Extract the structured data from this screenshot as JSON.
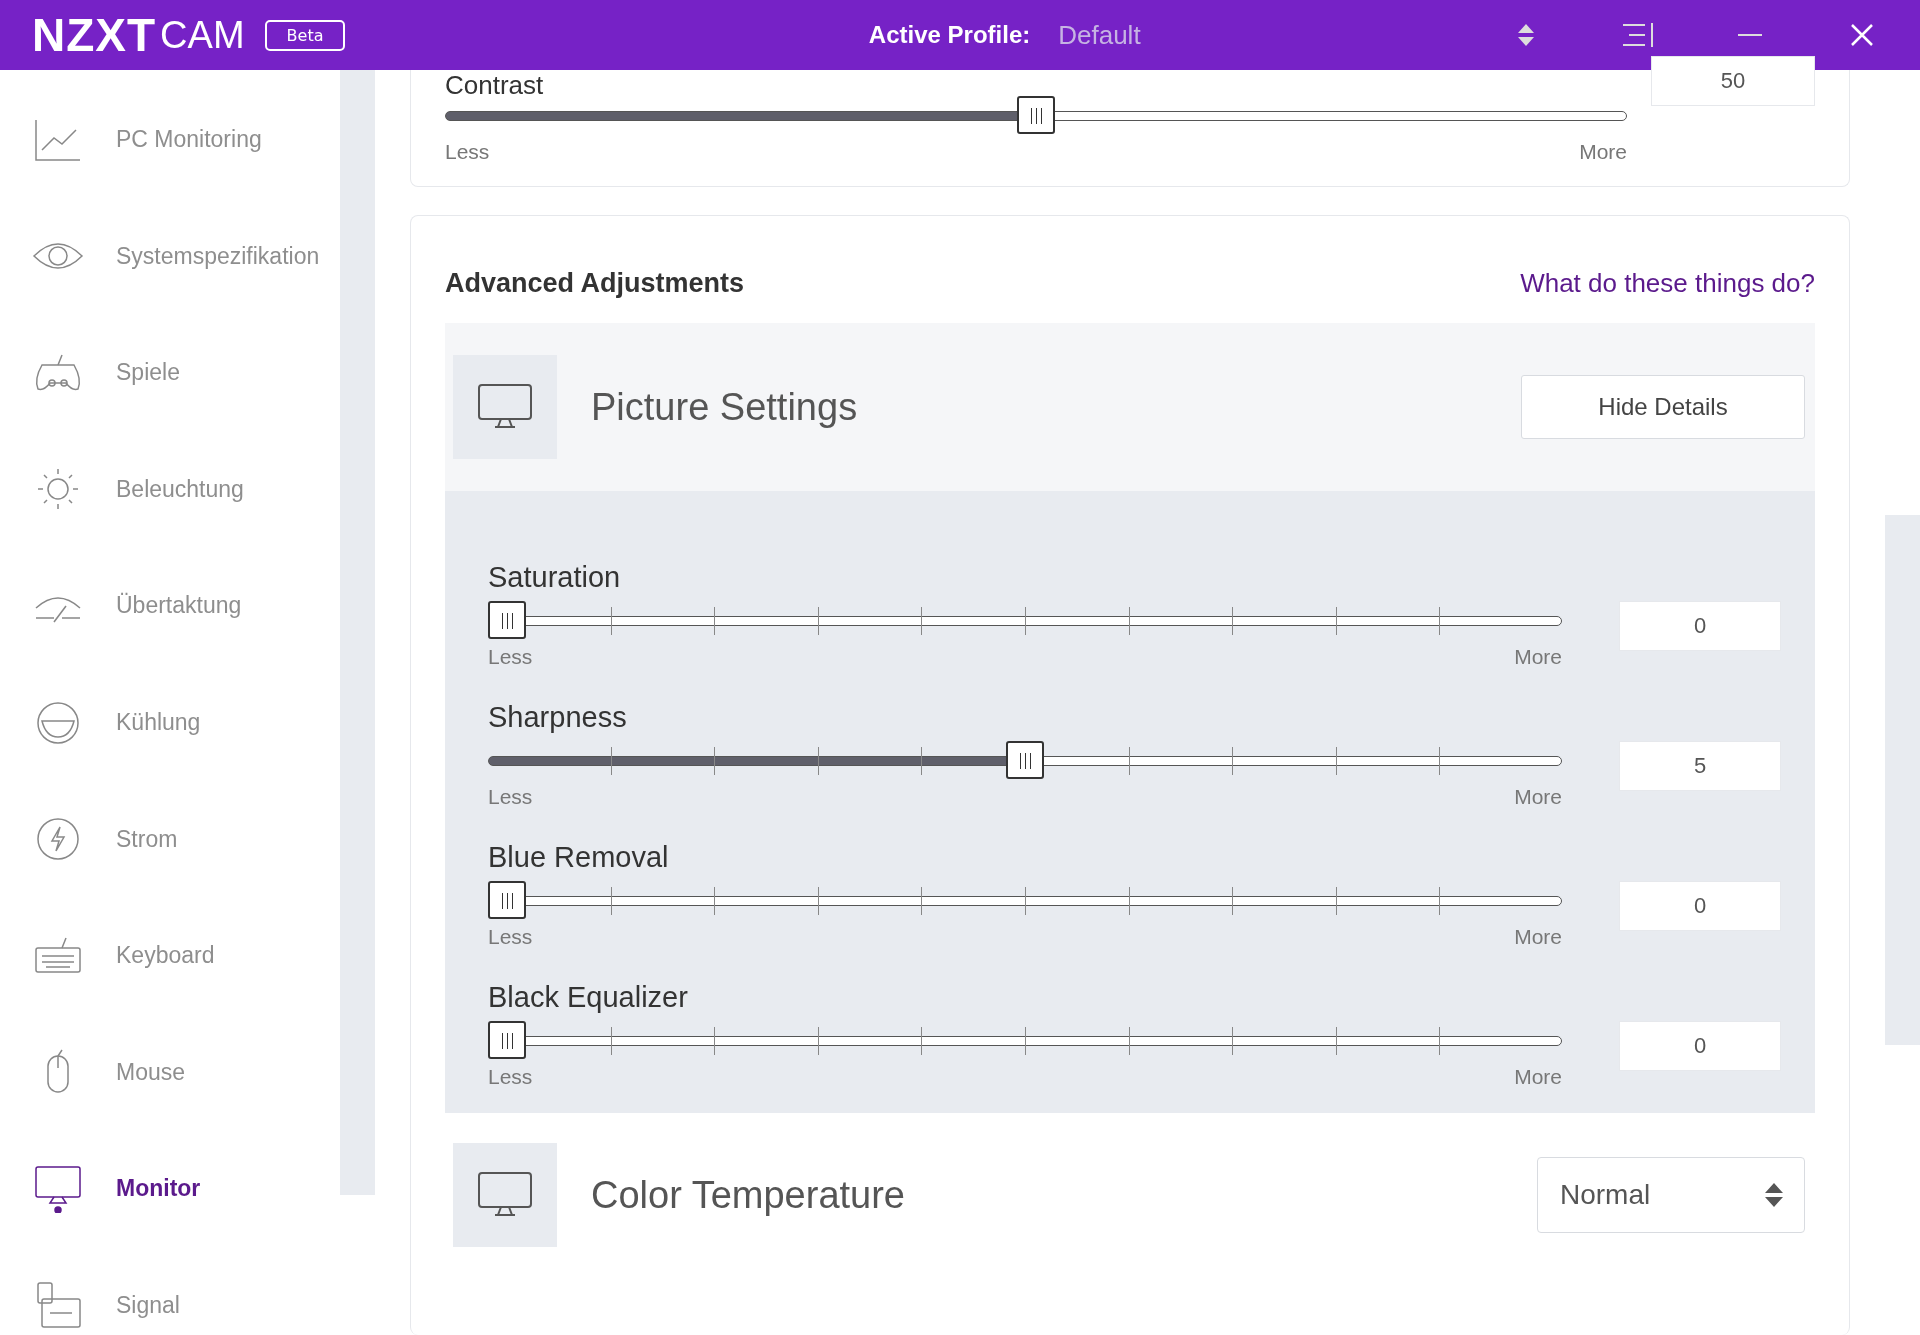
{
  "header": {
    "logo_main": "NZXT",
    "logo_sub": "CAM",
    "badge": "Beta",
    "profile_label": "Active Profile:",
    "profile_value": "Default"
  },
  "sidebar": {
    "items": [
      {
        "label": "PC Monitoring",
        "selected": false
      },
      {
        "label": "Systemspezifikation",
        "selected": false
      },
      {
        "label": "Spiele",
        "selected": false
      },
      {
        "label": "Beleuchtung",
        "selected": false
      },
      {
        "label": "Übertaktung",
        "selected": false
      },
      {
        "label": "Kühlung",
        "selected": false
      },
      {
        "label": "Strom",
        "selected": false
      },
      {
        "label": "Keyboard",
        "selected": false
      },
      {
        "label": "Mouse",
        "selected": false
      },
      {
        "label": "Monitor",
        "selected": true
      },
      {
        "label": "Signal",
        "selected": false
      }
    ]
  },
  "contrast": {
    "label": "Contrast",
    "level": 0.5,
    "less": "Less",
    "more": "More",
    "value": "50"
  },
  "advanced": {
    "title": "Advanced Adjustments",
    "help_link": "What do these things do?",
    "picture_settings": {
      "title": "Picture Settings",
      "button": "Hide Details",
      "sliders": [
        {
          "label": "Saturation",
          "level": 0,
          "less": "Less",
          "more": "More",
          "value": "0"
        },
        {
          "label": "Sharpness",
          "level": 0.5,
          "less": "Less",
          "more": "More",
          "value": "5"
        },
        {
          "label": "Blue Removal",
          "level": 0,
          "less": "Less",
          "more": "More",
          "value": "0"
        },
        {
          "label": "Black Equalizer",
          "level": 0,
          "less": "Less",
          "more": "More",
          "value": "0"
        }
      ]
    },
    "color_temperature": {
      "title": "Color Temperature",
      "value": "Normal"
    }
  }
}
